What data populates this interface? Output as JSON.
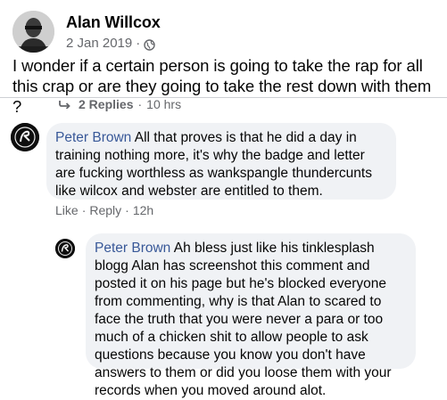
{
  "post": {
    "author": "Alan Willcox",
    "date": "2 Jan 2019",
    "separator": "·",
    "privacy_icon": "globe-icon",
    "text": "I wonder if a certain person is going to take the rap for all this crap or are they going to take the rest down with them ?"
  },
  "replies": {
    "icon": "reply-arrow-icon",
    "label": "2 Replies",
    "separator": "·",
    "time": "10 hrs"
  },
  "comments": [
    {
      "author": "Peter Brown",
      "text": "All that proves is that he did a day in training nothing more, it's why the badge and letter are fucking worthless as wankspangle thundercunts like wilcox and webster are entitled to them.",
      "actions": {
        "like": "Like",
        "reply": "Reply",
        "time": "12h",
        "sep": "·"
      }
    },
    {
      "author": "Peter Brown",
      "text": "Ah bless just like his tinklesplash blogg Alan has screenshot this comment and posted it on his page but he's blocked everyone from commenting, why is that Alan to scared to face the truth that you were never a para or too much of a chicken shit to allow people to ask questions because you know you don't have answers to them or did you loose them with your records when you moved around alot."
    }
  ],
  "colors": {
    "link": "#385898",
    "muted": "#65676b",
    "bubble": "#f0f2f5",
    "text": "#050505"
  }
}
